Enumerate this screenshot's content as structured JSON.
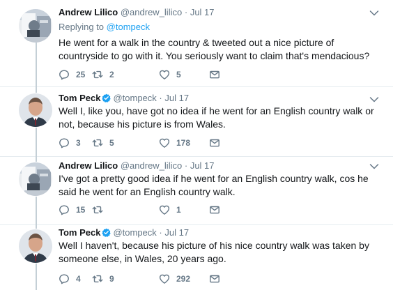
{
  "colors": {
    "accent": "#1da1f2",
    "muted": "#657786",
    "text": "#14171a",
    "rail": "#c4cfd6"
  },
  "tweets": [
    {
      "name": "Andrew Lilico",
      "handle": "@andrew_lilico",
      "dot": "·",
      "date": "Jul 17",
      "verified": false,
      "replying_prefix": "Replying to ",
      "replying_handle": "@tompeck",
      "text": "He went for a walk in the country & tweeted out a nice picture of countryside to go with it. You seriously want to claim that's mendacious?",
      "replies": "25",
      "retweets": "2",
      "likes": "5"
    },
    {
      "name": "Tom Peck",
      "handle": "@tompeck",
      "dot": "·",
      "date": "Jul 17",
      "verified": true,
      "text": "Well I, like you, have got no idea if he went for an English country walk or not, because his picture is from Wales.",
      "replies": "3",
      "retweets": "5",
      "likes": "178"
    },
    {
      "name": "Andrew Lilico",
      "handle": "@andrew_lilico",
      "dot": "·",
      "date": "Jul 17",
      "verified": false,
      "text": "I've got a pretty good idea if he went for an English country walk, cos he said he went for an English country walk.",
      "replies": "15",
      "retweets": "",
      "likes": "1"
    },
    {
      "name": "Tom Peck",
      "handle": "@tompeck",
      "dot": "·",
      "date": "Jul 17",
      "verified": true,
      "text": "Well I haven't, because his picture of his nice country walk was taken by someone else, in Wales, 20 years ago.",
      "replies": "4",
      "retweets": "9",
      "likes": "292"
    }
  ]
}
